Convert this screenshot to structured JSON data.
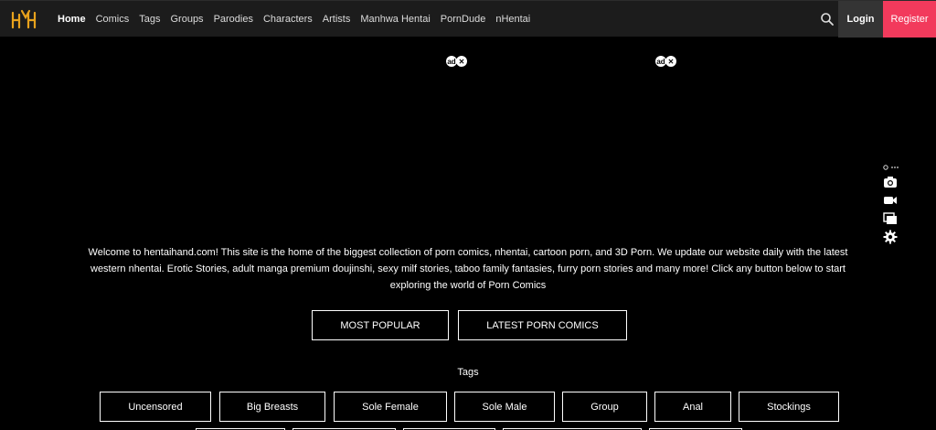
{
  "nav": {
    "logo_alt": "HH",
    "links": [
      "Home",
      "Comics",
      "Tags",
      "Groups",
      "Parodies",
      "Characters",
      "Artists",
      "Manhwa Hentai",
      "PornDude",
      "nHentai"
    ],
    "login_label": "Login",
    "register_label": "Register",
    "accent_color": "#f23a5c",
    "logo_color": "#e8a21c"
  },
  "intro_text": "Welcome to hentaihand.com! This site is the home of the biggest collection of porn comics, nhentai, cartoon porn, and 3D Porn. We update our website daily with the latest western nhentai. Erotic Stories, adult manga premium doujinshi, sexy milf stories, taboo family fantasies, furry porn stories and many more! Click any button below to start exploring the world of Porn Comics",
  "cta": {
    "most_popular": "MOST POPULAR",
    "latest": "LATEST PORN COMICS"
  },
  "tags": {
    "heading": "Tags",
    "items": [
      "Uncensored",
      "Big Breasts",
      "Sole Female",
      "Sole Male",
      "Group",
      "Anal",
      "Stockings"
    ]
  },
  "side_tools": [
    "link-icon",
    "camera-icon",
    "video-icon",
    "gallery-icon",
    "gear-icon"
  ]
}
